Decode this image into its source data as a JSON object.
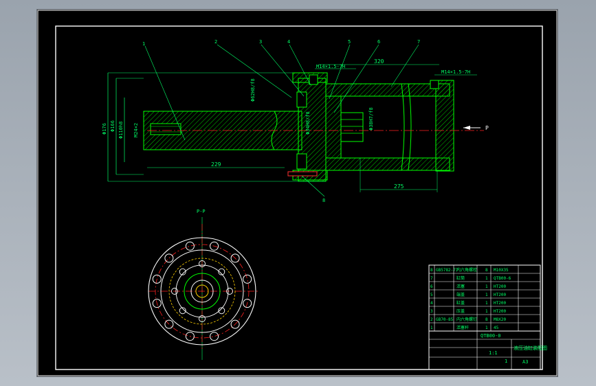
{
  "drawing": {
    "part_numbers": [
      "1",
      "2",
      "3",
      "4",
      "5",
      "6",
      "7",
      "8"
    ],
    "dimensions": {
      "d176": "Φ176",
      "d166": "Φ166",
      "d110": "Φ110h8",
      "thread_m24": "M24×2",
      "thread_top1": "M14×1.5-7H",
      "thread_top2": "M14×1.5-7H",
      "d320": "320",
      "d229": "229",
      "d275": "275",
      "d38": "Φ38H7/f8",
      "d62": "Φ62H8/f8",
      "d34": "Φ34H8/f8"
    },
    "view_label": "P",
    "section_label": "P-P"
  },
  "title_block": {
    "name": "液压油缸装配图",
    "code": "QTB00-0",
    "scale": "1:1",
    "size": "A3",
    "sheet": "1"
  },
  "parts_list": [
    {
      "no": "8",
      "code": "GB5782-77",
      "name": "内六角螺栓",
      "qty": "8",
      "note": "M10X35"
    },
    {
      "no": "7",
      "code": "",
      "name": "缸筒",
      "qty": "1",
      "note": "QTB00-6"
    },
    {
      "no": "6",
      "code": "",
      "name": "活塞",
      "qty": "1",
      "note": "HT200"
    },
    {
      "no": "5",
      "code": "",
      "name": "端盖",
      "qty": "1",
      "note": "HT200"
    },
    {
      "no": "4",
      "code": "",
      "name": "缸盖",
      "qty": "1",
      "note": "HT200"
    },
    {
      "no": "3",
      "code": "",
      "name": "压盖",
      "qty": "1",
      "note": "HT200"
    },
    {
      "no": "2",
      "code": "GB70-85",
      "name": "内六角螺钉",
      "qty": "8",
      "note": "M8X20"
    },
    {
      "no": "1",
      "code": "",
      "name": "活塞杆",
      "qty": "1",
      "note": "45"
    }
  ],
  "colors": {
    "background": "#000000",
    "frame": "#ffffff",
    "geometry": "#00ff00",
    "hatch": "#00c800",
    "centerline": "#ff2020",
    "hidden": "#ffd000",
    "annotation": "#00ff66"
  }
}
